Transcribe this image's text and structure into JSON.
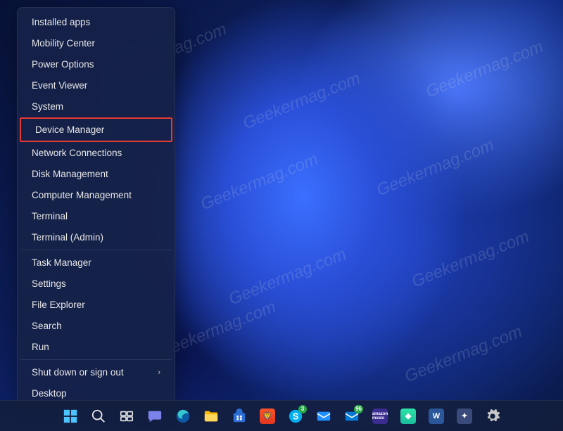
{
  "watermark_text": "Geekermag.com",
  "menu": {
    "highlighted_index": 5,
    "items": [
      {
        "label": "Installed apps",
        "separator_after": false
      },
      {
        "label": "Mobility Center",
        "separator_after": false
      },
      {
        "label": "Power Options",
        "separator_after": false
      },
      {
        "label": "Event Viewer",
        "separator_after": false
      },
      {
        "label": "System",
        "separator_after": false
      },
      {
        "label": "Device Manager",
        "separator_after": false
      },
      {
        "label": "Network Connections",
        "separator_after": false
      },
      {
        "label": "Disk Management",
        "separator_after": false
      },
      {
        "label": "Computer Management",
        "separator_after": false
      },
      {
        "label": "Terminal",
        "separator_after": false
      },
      {
        "label": "Terminal (Admin)",
        "separator_after": true
      },
      {
        "label": "Task Manager",
        "separator_after": false
      },
      {
        "label": "Settings",
        "separator_after": false
      },
      {
        "label": "File Explorer",
        "separator_after": false
      },
      {
        "label": "Search",
        "separator_after": false
      },
      {
        "label": "Run",
        "separator_after": true
      },
      {
        "label": "Shut down or sign out",
        "has_submenu": true,
        "separator_after": false
      },
      {
        "label": "Desktop",
        "separator_after": false
      }
    ]
  },
  "taskbar": {
    "icons": [
      {
        "name": "start-icon"
      },
      {
        "name": "search-icon"
      },
      {
        "name": "task-view-icon"
      },
      {
        "name": "chat-icon"
      },
      {
        "name": "edge-icon"
      },
      {
        "name": "file-explorer-icon"
      },
      {
        "name": "store-icon"
      },
      {
        "name": "brave-icon"
      },
      {
        "name": "skype-icon",
        "badge": "3"
      },
      {
        "name": "mail-icon"
      },
      {
        "name": "onenote-icon",
        "badge": "96"
      },
      {
        "name": "amazon-music-icon"
      },
      {
        "name": "app-icon-1"
      },
      {
        "name": "word-icon"
      },
      {
        "name": "app-icon-2"
      },
      {
        "name": "settings-icon"
      }
    ]
  }
}
